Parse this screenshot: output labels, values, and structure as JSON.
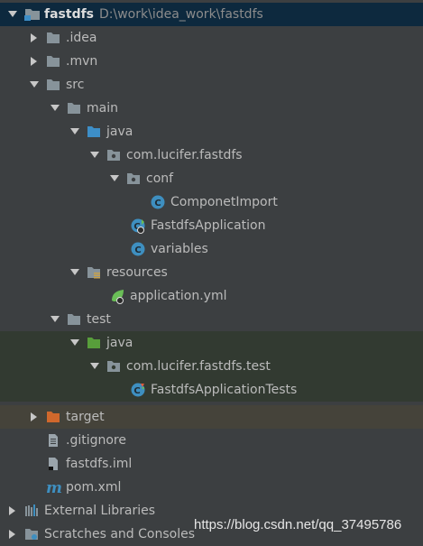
{
  "tree": {
    "root": {
      "label": "fastdfs",
      "path": "D:\\work\\idea_work\\fastdfs"
    },
    "idea": "idea",
    "mvn": "mvn",
    "src": "src",
    "main": "main",
    "main_java": "java",
    "main_package": "com.lucifer.fastdfs",
    "conf": "conf",
    "componet_import": "ComponetImport",
    "fastdfs_application": "FastdfsApplication",
    "variables": "variables",
    "resources": "resources",
    "application_yml": "application.yml",
    "test": "test",
    "test_java": "java",
    "test_package": "com.lucifer.fastdfs.test",
    "fastdfs_application_tests": "FastdfsApplicationTests",
    "target": "target",
    "gitignore": ".gitignore",
    "fastdfs_iml": "fastdfs.iml",
    "pom_xml": "pom.xml",
    "external_libraries": "External Libraries",
    "scratches": "Scratches and Consoles"
  },
  "watermark": "https://blog.csdn.net/qq_37495786",
  "colors": {
    "background": "#3c3f41",
    "selection": "#0d293e",
    "test_band": "#323a31",
    "excluded_band": "#45433a",
    "folder": "#87939a",
    "source_folder": "#3d8ec7",
    "test_folder": "#589e3b",
    "excluded_folder": "#d0682c",
    "class_icon": "#3e8fc0"
  }
}
